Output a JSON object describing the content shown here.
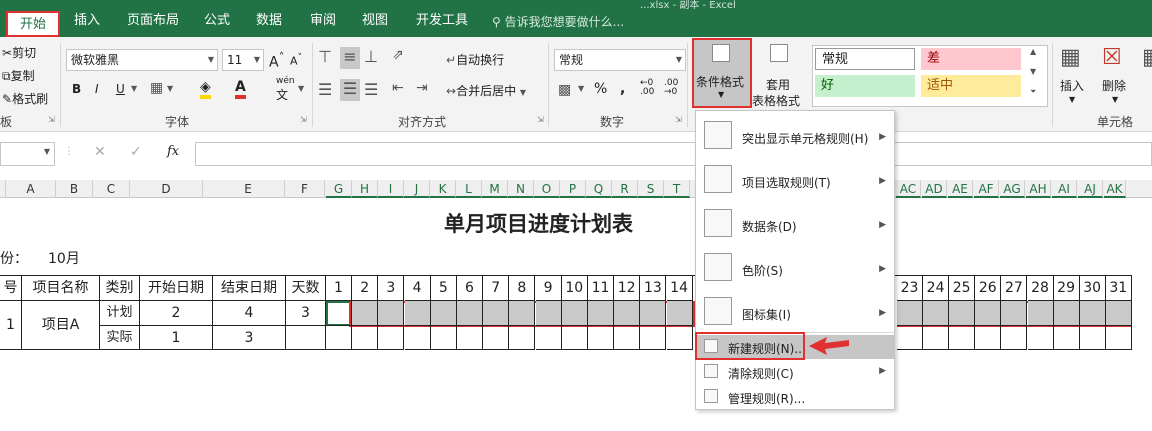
{
  "titlebar": {
    "text": "...xlsx - 副本 - Excel"
  },
  "tabs": [
    "开始",
    "插入",
    "页面布局",
    "公式",
    "数据",
    "审阅",
    "视图",
    "开发工具"
  ],
  "tellme": "告诉我您想要做什么...",
  "clipboard": {
    "cut": "剪切",
    "copy": "复制",
    "painter": "格式刷",
    "label": "板"
  },
  "font": {
    "name": "微软雅黑",
    "size": "11",
    "label": "字体",
    "wen": "wén"
  },
  "alignment": {
    "wrap": "自动换行",
    "merge": "合并后居中",
    "label": "对齐方式"
  },
  "number": {
    "format": "常规",
    "label": "数字"
  },
  "styles": {
    "cond_format": "条件格式",
    "table_format_1": "套用",
    "table_format_2": "表格格式",
    "boxes": [
      {
        "text": "常规",
        "bg": "#ffffff",
        "color": "#222222"
      },
      {
        "text": "差",
        "bg": "#ffc7ce",
        "color": "#9c0006"
      },
      {
        "text": "好",
        "bg": "#c6efce",
        "color": "#006100"
      },
      {
        "text": "适中",
        "bg": "#ffeb9c",
        "color": "#9c5700"
      }
    ]
  },
  "cells": {
    "insert": "插入",
    "delete": "删除",
    "label": "单元格"
  },
  "formula_bar": {
    "fx": "fx"
  },
  "columns": [
    "A",
    "B",
    "C",
    "D",
    "E",
    "F",
    "G",
    "H",
    "I",
    "J",
    "K",
    "L",
    "M",
    "N",
    "O",
    "P",
    "Q",
    "R",
    "S",
    "T",
    "AC",
    "AD",
    "AE",
    "AF",
    "AG",
    "AH",
    "AI",
    "AJ",
    "AK"
  ],
  "sheet": {
    "title": "单月项目进度计划表",
    "month_label": "份：",
    "month_value": "10月",
    "headers": [
      "号",
      "项目名称",
      "类别",
      "开始日期",
      "结束日期",
      "天数"
    ],
    "days_left": [
      "1",
      "2",
      "3",
      "4",
      "5",
      "6",
      "7",
      "8",
      "9",
      "10",
      "11",
      "12",
      "13",
      "14"
    ],
    "days_right": [
      "23",
      "24",
      "25",
      "26",
      "27",
      "28",
      "29",
      "30",
      "31"
    ],
    "row_no": "1",
    "project": "项目A",
    "plan": {
      "type": "计划",
      "start": "2",
      "end": "4",
      "days": "3"
    },
    "actual": {
      "type": "实际",
      "start": "1",
      "end": "3"
    }
  },
  "cond_menu": {
    "items": [
      {
        "label": "突出显示单元格规则(H)",
        "submenu": true,
        "icon": "highlight-rules-icon"
      },
      {
        "label": "项目选取规则(T)",
        "submenu": true,
        "icon": "top-bottom-rules-icon"
      },
      {
        "label": "数据条(D)",
        "submenu": true,
        "icon": "data-bars-icon"
      },
      {
        "label": "色阶(S)",
        "submenu": true,
        "icon": "color-scales-icon"
      },
      {
        "label": "图标集(I)",
        "submenu": true,
        "icon": "icon-sets-icon"
      }
    ],
    "small_items": [
      {
        "label": "新建规则(N)...",
        "submenu": false,
        "icon": "new-rule-icon"
      },
      {
        "label": "清除规则(C)",
        "submenu": true,
        "icon": "clear-rules-icon"
      },
      {
        "label": "管理规则(R)...",
        "submenu": false,
        "icon": "manage-rules-icon"
      }
    ]
  },
  "accent": {
    "excel_green": "#217346",
    "highlight_red": "#e03030",
    "bar_gray": "#c9c9c9"
  }
}
